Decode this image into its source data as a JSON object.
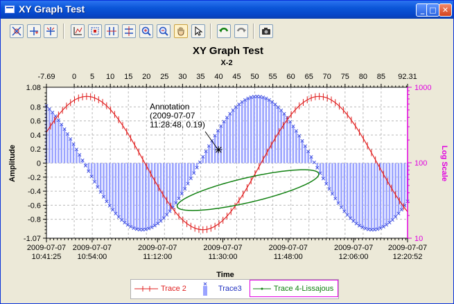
{
  "window": {
    "title": "XY Graph Test"
  },
  "titlebar_buttons": [
    {
      "name": "minimize-button",
      "glyph": "_"
    },
    {
      "name": "maximize-button",
      "glyph": "□"
    },
    {
      "name": "close-button",
      "glyph": "✕"
    }
  ],
  "toolbar": {
    "tools": [
      {
        "name": "autoscale-tool",
        "icon": "autoscale-icon",
        "active": false
      },
      {
        "name": "cursor-plus-tool",
        "icon": "cursor-plus-icon",
        "active": false
      },
      {
        "name": "cursor-cross-tool",
        "icon": "cursor-cross-icon",
        "active": false
      },
      {
        "name": "axis-edit-tool",
        "icon": "axis-edit-icon",
        "active": false
      },
      {
        "name": "zoom-box-tool",
        "icon": "zoom-box-icon",
        "active": false
      },
      {
        "name": "horizontal-zoom-tool",
        "icon": "horizontal-zoom-icon",
        "active": false
      },
      {
        "name": "vertical-zoom-tool",
        "icon": "vertical-zoom-icon",
        "active": false
      },
      {
        "name": "zoom-in-tool",
        "icon": "zoom-in-icon",
        "active": false
      },
      {
        "name": "zoom-out-tool",
        "icon": "zoom-out-icon",
        "active": false
      },
      {
        "name": "pan-tool",
        "icon": "hand-icon",
        "active": true
      },
      {
        "name": "pointer-tool",
        "icon": "arrow-icon",
        "active": false
      },
      {
        "name": "undo-tool",
        "icon": "undo-icon",
        "active": false
      },
      {
        "name": "redo-tool",
        "icon": "redo-icon",
        "active": false
      },
      {
        "name": "snapshot-tool",
        "icon": "camera-icon",
        "active": false
      }
    ]
  },
  "chart_data": {
    "type": "line",
    "title": "XY Graph Test",
    "grid": true,
    "x_axis_bottom": {
      "label": "Time",
      "tick_labels": [
        [
          "2009-07-07",
          "10:41:25"
        ],
        [
          "2009-07-07",
          "10:54:00"
        ],
        [
          "2009-07-07",
          "11:12:00"
        ],
        [
          "2009-07-07",
          "11:30:00"
        ],
        [
          "2009-07-07",
          "11:48:00"
        ],
        [
          "2009-07-07",
          "12:06:00"
        ],
        [
          "2009-07-07",
          "12:20:52"
        ]
      ],
      "tick_times_min": [
        0,
        12.58,
        30.58,
        48.58,
        66.58,
        84.58,
        99.45
      ]
    },
    "x_axis_top": {
      "label": "X-2",
      "range": [
        -7.69,
        92.31
      ],
      "tick_labels": [
        "-7.69",
        "0",
        "5",
        "10",
        "15",
        "20",
        "25",
        "30",
        "35",
        "40",
        "45",
        "50",
        "55",
        "60",
        "65",
        "70",
        "75",
        "80",
        "85",
        "92.31"
      ],
      "ticks": [
        -7.69,
        0,
        5,
        10,
        15,
        20,
        25,
        30,
        35,
        40,
        45,
        50,
        55,
        60,
        65,
        70,
        75,
        80,
        85,
        92.31
      ]
    },
    "y_axis_left": {
      "label": "Amplitude",
      "range": [
        -1.07,
        1.08
      ],
      "tick_labels": [
        "1.08",
        "0.8",
        "0.6",
        "0.4",
        "0.2",
        "0",
        "-0.2",
        "-0.4",
        "-0.6",
        "-0.8",
        "-1.07"
      ],
      "ticks": [
        1.08,
        0.8,
        0.6,
        0.4,
        0.2,
        0,
        -0.2,
        -0.4,
        -0.6,
        -0.8,
        -1.07
      ]
    },
    "y_axis_right": {
      "label": "Log Scale",
      "scale": "log",
      "range": [
        10,
        1000
      ],
      "tick_labels": [
        "1000",
        "100",
        "10"
      ],
      "ticks": [
        1000,
        100,
        10
      ],
      "color": "#e000e0"
    },
    "series": [
      {
        "name": "Trace 2",
        "kind": "line-with-error-bars",
        "color": "#e02020",
        "x_range_min": [
          0,
          99.45
        ],
        "y_start": 0.19,
        "peaks": [
          {
            "x_min": 11,
            "y": 0.95
          },
          {
            "x_min": 75,
            "y": 0.95
          }
        ],
        "troughs": [
          {
            "x_min": 42.5,
            "y": -0.96
          }
        ],
        "y_end": -0.56
      },
      {
        "name": "Trace3",
        "kind": "bars-from-zero",
        "color": "#6070ff",
        "x_range_min": [
          0,
          99.45
        ],
        "y_start": 0.95,
        "troughs": [
          {
            "x_min": 26,
            "y": -0.95
          },
          {
            "x_min": 89.5,
            "y": -0.95
          }
        ],
        "peaks": [
          {
            "x_min": 58,
            "y": 0.95
          }
        ],
        "y_end": -0.83
      },
      {
        "name": "Trace 4-Lissajous",
        "kind": "closed-curve",
        "color": "#108010",
        "x_extent_min": [
          36,
          75
        ],
        "y_extent": [
          -0.69,
          -0.08
        ]
      }
    ],
    "annotations": [
      {
        "text": [
          "Annotation",
          "(2009-07-07",
          "11:28:48, 0.19)"
        ],
        "x_min": 47.4,
        "y": 0.19
      }
    ],
    "legend": {
      "position": "bottom",
      "items": [
        "Trace 2",
        "Trace3",
        "Trace 4-Lissajous"
      ]
    }
  }
}
